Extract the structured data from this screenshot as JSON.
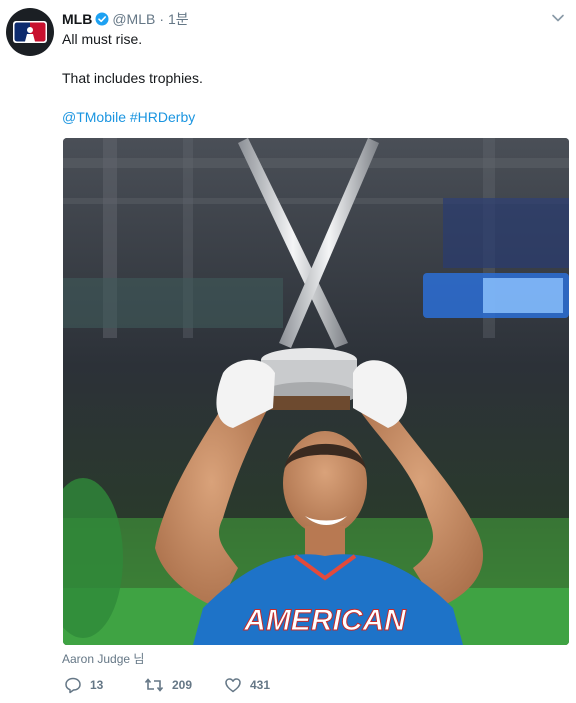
{
  "tweet": {
    "author_name": "MLB",
    "author_handle": "@MLB",
    "separator": "·",
    "timestamp": "1분",
    "lines": [
      "All must rise.",
      "That includes trophies.",
      "@TMobile #HRDerby"
    ],
    "tagged_user": "Aaron Judge 님",
    "jersey_text": "AMERICAN",
    "stats": {
      "replies": "13",
      "retweets": "209",
      "likes": "431"
    }
  },
  "icons": {
    "verified": "verified-badge-icon",
    "caret": "chevron-down-icon",
    "reply": "reply-icon",
    "retweet": "retweet-icon",
    "like": "heart-icon"
  },
  "colors": {
    "link": "#1b95e0",
    "verified": "#1da1f2",
    "muted": "#657786",
    "jersey": "#1e73c8"
  }
}
